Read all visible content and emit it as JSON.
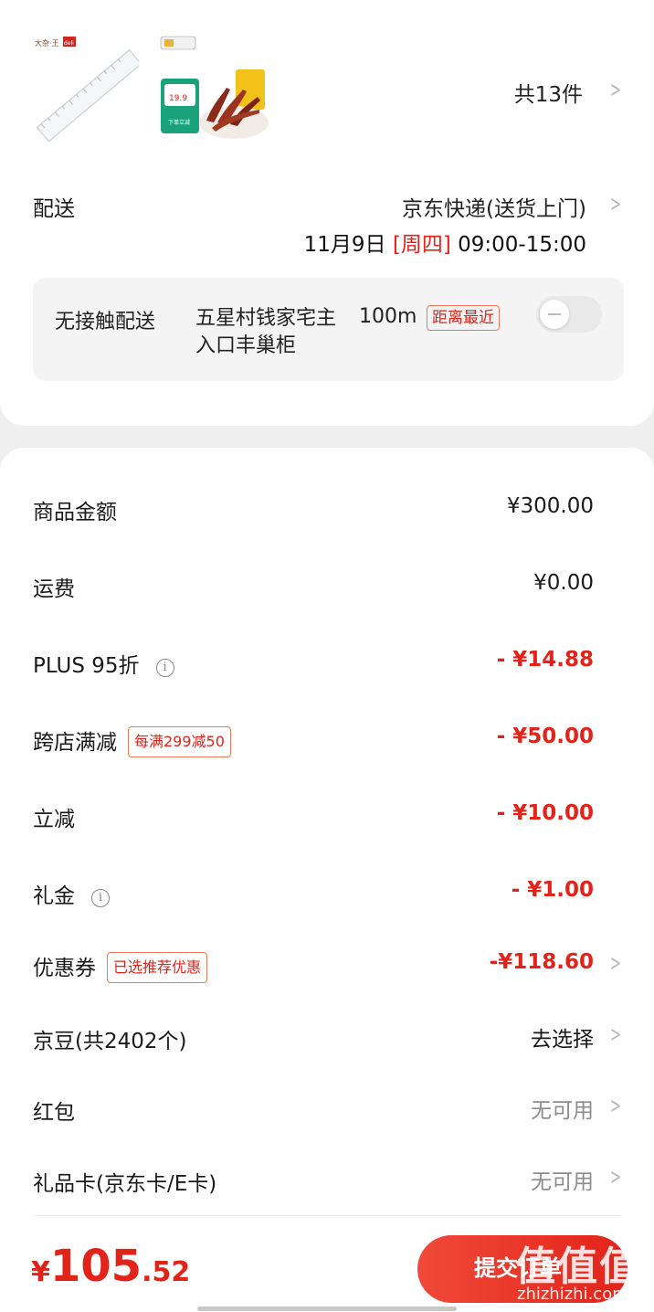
{
  "products": {
    "count_label": "共13件",
    "shop1_logo": "deli",
    "shop2_logo": "",
    "coupon_price": "19.9",
    "coupon_text": "下单立减"
  },
  "delivery": {
    "label": "配送",
    "method": "京东快递(送货上门)",
    "date": "11月9日",
    "weekday": "[周四]",
    "time": "09:00-15:00",
    "no_contact": {
      "title": "无接触配送",
      "address": "五星村钱家宅主入口丰巢柜",
      "distance": "100m",
      "tag": "距离最近",
      "enabled": false
    }
  },
  "summary": {
    "rows": [
      {
        "label": "商品金额",
        "value": "¥300.00",
        "style": "normal"
      },
      {
        "label": "运费",
        "value": "¥0.00",
        "style": "normal"
      },
      {
        "label": "PLUS 95折",
        "value": "- ¥14.88",
        "style": "red",
        "info": true
      },
      {
        "label": "跨店满减",
        "value": "- ¥50.00",
        "style": "red",
        "tag": "每满299减50"
      },
      {
        "label": "立减",
        "value": "- ¥10.00",
        "style": "red"
      },
      {
        "label": "礼金",
        "value": "- ¥1.00",
        "style": "red",
        "info": true
      },
      {
        "label": "优惠券",
        "value": "-¥118.60",
        "style": "red",
        "tag": "已选推荐优惠",
        "arrow": true
      },
      {
        "label": "京豆(共2402个)",
        "value": "去选择",
        "style": "normal",
        "arrow": true
      },
      {
        "label": "红包",
        "value": "无可用",
        "style": "gray",
        "arrow": true
      },
      {
        "label": "礼品卡(京东卡/E卡)",
        "value": "无可用",
        "style": "gray",
        "arrow": true
      }
    ]
  },
  "footer": {
    "currency": "¥",
    "total_int": "105",
    "total_dec": ".52",
    "submit_label": "提交订单",
    "watermark_big": "值值值",
    "watermark_small": "zhizhizhi.com"
  },
  "colors": {
    "accent": "#e2231a",
    "background": "#efefef",
    "muted": "#8c8c8c"
  }
}
